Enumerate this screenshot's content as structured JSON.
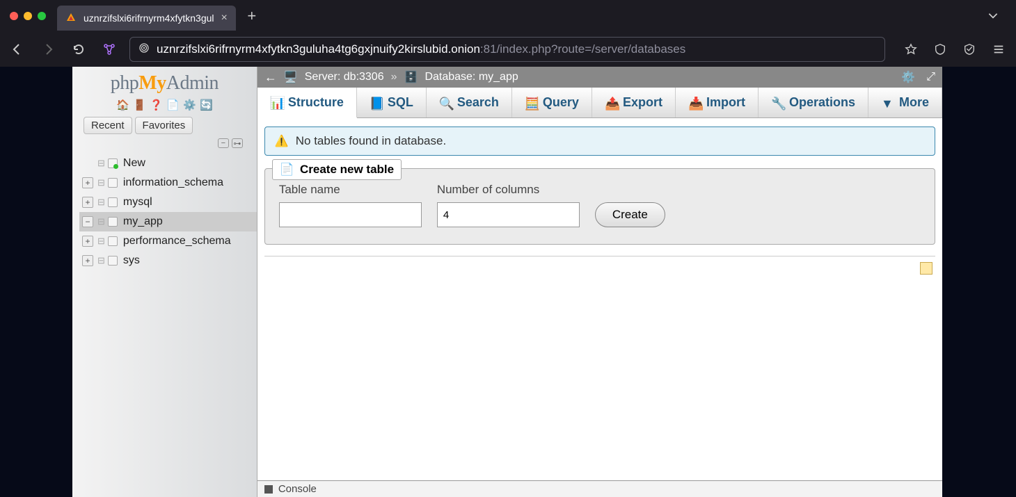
{
  "browser": {
    "tab_title": "uznrzifslxi6rifrnyrm4xfytkn3gul",
    "url_host": "uznrzifslxi6rifrnyrm4xfytkn3guluha4tg6gxjnuify2kirslubid.onion",
    "url_path": ":81/index.php?route=/server/databases"
  },
  "logo": {
    "php": "php",
    "my": "My",
    "admin": "Admin"
  },
  "sidebar": {
    "recent_label": "Recent",
    "favorites_label": "Favorites",
    "items": [
      {
        "label": "New",
        "toggle": "",
        "new": true
      },
      {
        "label": "information_schema",
        "toggle": "+"
      },
      {
        "label": "mysql",
        "toggle": "+"
      },
      {
        "label": "my_app",
        "toggle": "−",
        "selected": true
      },
      {
        "label": "performance_schema",
        "toggle": "+"
      },
      {
        "label": "sys",
        "toggle": "+"
      }
    ]
  },
  "breadcrumb": {
    "server_label": "Server: db:3306",
    "database_label": "Database: my_app"
  },
  "tabs": [
    {
      "label": "Structure",
      "active": true
    },
    {
      "label": "SQL"
    },
    {
      "label": "Search"
    },
    {
      "label": "Query"
    },
    {
      "label": "Export"
    },
    {
      "label": "Import"
    },
    {
      "label": "Operations"
    },
    {
      "label": "More",
      "dropdown": true
    }
  ],
  "alert": {
    "text": "No tables found in database."
  },
  "create_table": {
    "legend": "Create new table",
    "table_name_label": "Table name",
    "table_name_value": "",
    "num_cols_label": "Number of columns",
    "num_cols_value": "4",
    "button_label": "Create"
  },
  "console": {
    "label": "Console"
  }
}
